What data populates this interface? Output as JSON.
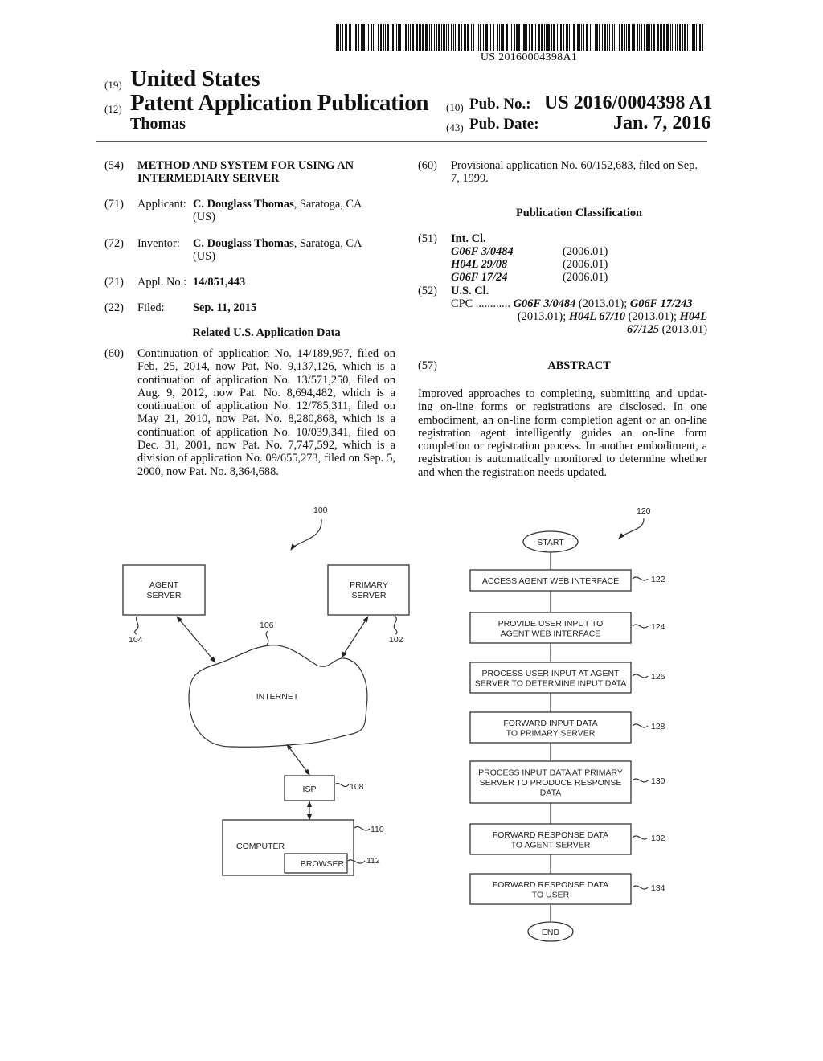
{
  "header": {
    "barcode_number": "US 20160004398A1",
    "code_19": "(19)",
    "country": "United States",
    "code_12": "(12)",
    "doc_type": "Patent Application Publication",
    "inventor_surname": "Thomas",
    "code_10": "(10)",
    "pub_no_label": "Pub. No.:",
    "pub_no_value": "US 2016/0004398 A1",
    "code_43": "(43)",
    "pub_date_label": "Pub. Date:",
    "pub_date_value": "Jan. 7, 2016"
  },
  "left_column": {
    "title": {
      "code": "(54)",
      "line1": "METHOD AND SYSTEM FOR USING AN",
      "line2": "INTERMEDIARY SERVER"
    },
    "applicant": {
      "code": "(71)",
      "label": "Applicant:",
      "name": "C. Douglass Thomas",
      "location": ", Saratoga, CA",
      "country": "(US)"
    },
    "inventor": {
      "code": "(72)",
      "label": "Inventor:",
      "name": "C. Douglass Thomas",
      "location": ", Saratoga, CA",
      "country": "(US)"
    },
    "appl_no": {
      "code": "(21)",
      "label": "Appl. No.:",
      "value": "14/851,443"
    },
    "filed": {
      "code": "(22)",
      "label": "Filed:",
      "value": "Sep. 11, 2015"
    },
    "related_heading": "Related U.S. Application Data",
    "continuation": {
      "code": "(60)",
      "lines": [
        "Continuation of application No. 14/189,957, filed on",
        "Feb. 25, 2014, now Pat. No. 9,137,126, which is a",
        "continuation of application No. 13/571,250, filed on",
        "Aug. 9, 2012, now Pat. No. 8,694,482, which is a",
        "continuation of application No. 12/785,311, filed on",
        "May 21, 2010, now Pat. No. 8,280,868, which is a",
        "continuation of application No. 10/039,341, filed on",
        "Dec. 31, 2001, now Pat. No. 7,747,592, which is a",
        "division of application No. 09/655,273, filed on Sep. 5,",
        "2000, now Pat. No. 8,364,688."
      ]
    }
  },
  "right_column": {
    "provisional": {
      "code": "(60)",
      "line1": "Provisional application No. 60/152,683, filed on Sep.",
      "line2": "7, 1999."
    },
    "classification_heading": "Publication Classification",
    "int_cl": {
      "code": "(51)",
      "label": "Int. Cl.",
      "entries": [
        {
          "class": "G06F 3/0484",
          "version": "(2006.01)"
        },
        {
          "class": "H04L 29/08",
          "version": "(2006.01)"
        },
        {
          "class": "G06F 17/24",
          "version": "(2006.01)"
        }
      ]
    },
    "us_cl": {
      "code": "(52)",
      "label": "U.S. Cl.",
      "cpc_label": "CPC ............",
      "cpc": [
        {
          "class": "G06F 3/0484",
          "version": "(2013.01);"
        },
        {
          "class": "G06F 17/243",
          "version": "(2013.01);"
        },
        {
          "class": "H04L 67/10",
          "version": "(2013.01);"
        },
        {
          "class": "H04L 67/125",
          "version": "(2013.01)"
        }
      ]
    },
    "abstract": {
      "code": "(57)",
      "heading": "ABSTRACT",
      "lines": [
        "Improved approaches to completing, submitting and updat-",
        "ing on-line forms or registrations are disclosed. In one",
        "embodiment, an on-line form completion agent or an on-line",
        "registration agent intelligently guides an on-line form",
        "completion or registration process. In another embodiment, a",
        "registration is automatically monitored to determine whether",
        "and when the registration needs updated."
      ]
    }
  },
  "figure_system": {
    "ref": "100",
    "agent_server": {
      "line1": "AGENT",
      "line2": "SERVER",
      "ref": "104"
    },
    "primary_server": {
      "line1": "PRIMARY",
      "line2": "SERVER",
      "ref": "102"
    },
    "internet": {
      "label": "INTERNET",
      "ref": "106"
    },
    "isp": {
      "label": "ISP",
      "ref": "108"
    },
    "computer": {
      "label": "COMPUTER",
      "ref": "110"
    },
    "browser": {
      "label": "BROWSER",
      "ref": "112"
    }
  },
  "figure_flow": {
    "ref": "120",
    "start": "START",
    "end": "END",
    "steps": [
      {
        "lines": [
          "ACCESS AGENT WEB INTERFACE"
        ],
        "ref": "122"
      },
      {
        "lines": [
          "PROVIDE USER INPUT TO",
          "AGENT WEB INTERFACE"
        ],
        "ref": "124"
      },
      {
        "lines": [
          "PROCESS USER INPUT AT AGENT",
          "SERVER TO DETERMINE INPUT DATA"
        ],
        "ref": "126"
      },
      {
        "lines": [
          "FORWARD INPUT DATA",
          "TO PRIMARY SERVER"
        ],
        "ref": "128"
      },
      {
        "lines": [
          "PROCESS INPUT DATA AT PRIMARY",
          "SERVER TO PRODUCE RESPONSE",
          "DATA"
        ],
        "ref": "130"
      },
      {
        "lines": [
          "FORWARD RESPONSE DATA",
          "TO AGENT SERVER"
        ],
        "ref": "132"
      },
      {
        "lines": [
          "FORWARD RESPONSE DATA",
          "TO USER"
        ],
        "ref": "134"
      }
    ]
  }
}
